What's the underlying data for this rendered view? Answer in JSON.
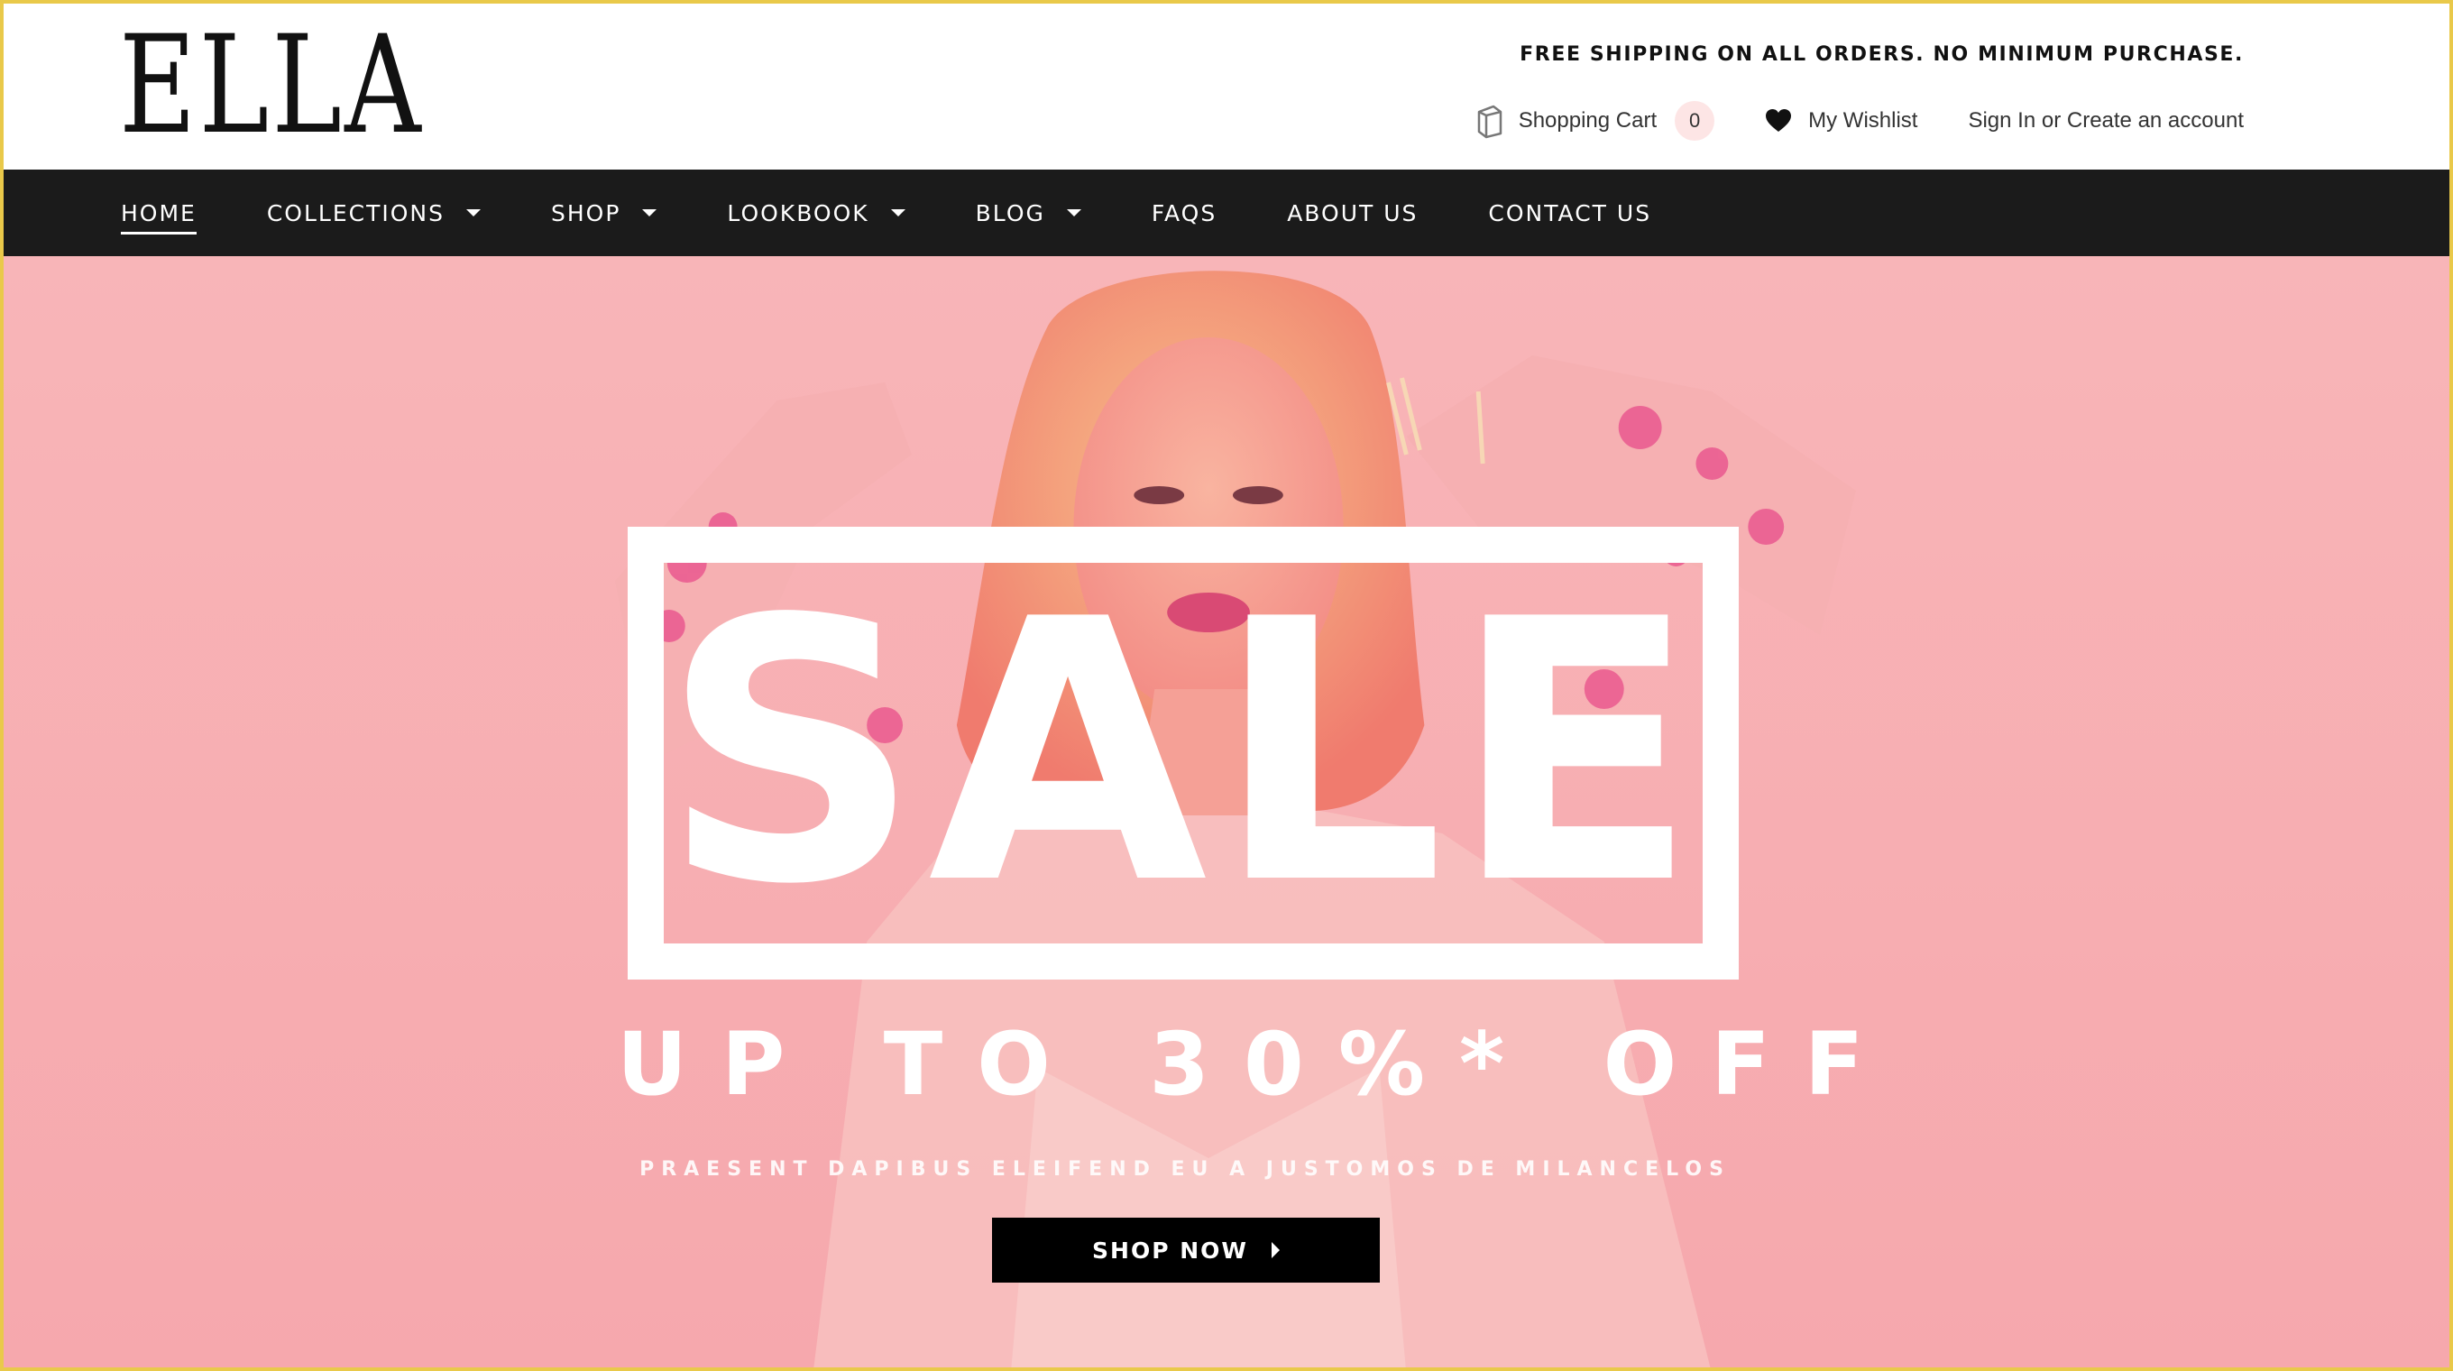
{
  "brand": {
    "logo": "ELLA"
  },
  "header": {
    "promo": "FREE SHIPPING ON ALL ORDERS. NO MINIMUM PURCHASE.",
    "cart_label": "Shopping Cart",
    "cart_count": "0",
    "wishlist_label": "My Wishlist",
    "account_label": "Sign In or Create an account"
  },
  "nav": {
    "items": [
      {
        "label": "HOME",
        "active": true,
        "dropdown": false
      },
      {
        "label": "COLLECTIONS",
        "active": false,
        "dropdown": true
      },
      {
        "label": "SHOP",
        "active": false,
        "dropdown": true
      },
      {
        "label": "LOOKBOOK",
        "active": false,
        "dropdown": true
      },
      {
        "label": "BLOG",
        "active": false,
        "dropdown": true
      },
      {
        "label": "FAQS",
        "active": false,
        "dropdown": false
      },
      {
        "label": "ABOUT US",
        "active": false,
        "dropdown": false
      },
      {
        "label": "CONTACT US",
        "active": false,
        "dropdown": false
      }
    ]
  },
  "hero": {
    "headline": "SALE",
    "discount": "UP TO 30%* OFF",
    "tagline": "PRAESENT DAPIBUS ELEIFEND EU A JUSTOMOS DE MILANCELOS",
    "cta_label": "SHOP NOW"
  },
  "icons": {
    "cart": "shopping-bag-icon",
    "wishlist": "heart-icon",
    "cta": "chevron-right-icon"
  },
  "colors": {
    "hero_background": "#f8b5b8",
    "nav_background": "#1b1b1b",
    "cart_badge": "#fde5e5",
    "cta_background": "#000000",
    "frame_border": "#e9c94a"
  }
}
